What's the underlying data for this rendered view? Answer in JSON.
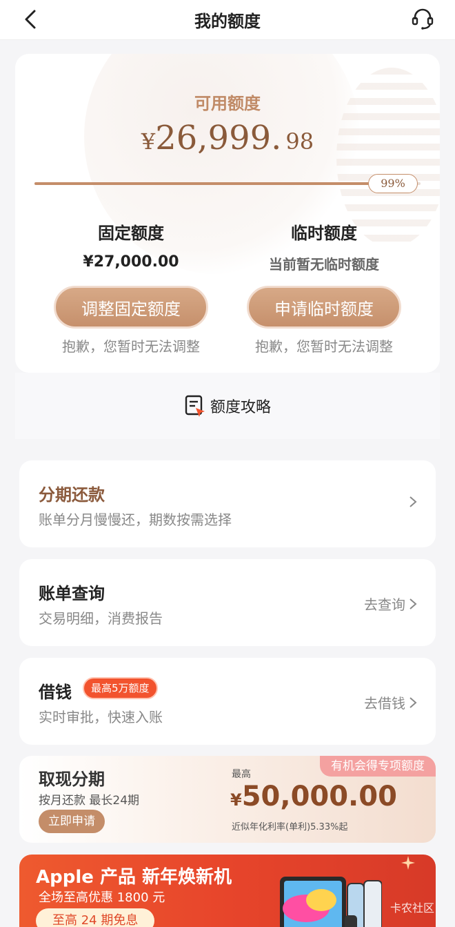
{
  "header": {
    "title": "我的额度"
  },
  "quota": {
    "label": "可用额度",
    "yen": "¥",
    "amount_main": "26,999.",
    "amount_dec": "98",
    "progress_pct": 99,
    "progress_label": "99%",
    "fixed": {
      "title": "固定额度",
      "value": "¥27,000.00",
      "button": "调整固定额度",
      "note": "抱歉，您暂时无法调整"
    },
    "temp": {
      "title": "临时额度",
      "value": "当前暂无临时额度",
      "button": "申请临时额度",
      "note": "抱歉，您暂时无法调整"
    }
  },
  "strategy": {
    "label": "额度攻略"
  },
  "rows": {
    "installment": {
      "title": "分期还款",
      "subtitle": "账单分月慢慢还，期数按需选择"
    },
    "bill": {
      "title": "账单查询",
      "subtitle": "交易明细，消费报告",
      "action": "去查询"
    },
    "borrow": {
      "title": "借钱",
      "badge": "最高5万额度",
      "subtitle": "实时审批，快速入账",
      "action": "去借钱"
    }
  },
  "cash": {
    "title": "取现分期",
    "subtitle": "按月还款 最长24期",
    "button": "立即申请",
    "tag": "有机会得专项额度",
    "max_label": "最高",
    "yen": "¥",
    "amount": "50,000.00",
    "rate": "近似年化利率(单利)5.33%起"
  },
  "banner": {
    "title": "Apple 产品 新年焕新机",
    "subtitle": "全场至高优惠 1800 元",
    "pill": "至高 24 期免息",
    "watermark": "卡农社区"
  },
  "colors": {
    "accent": "#c48d69",
    "brand_brown": "#8a5a3a",
    "badge_red": "#f2532e",
    "banner_red": "#e7452b"
  }
}
